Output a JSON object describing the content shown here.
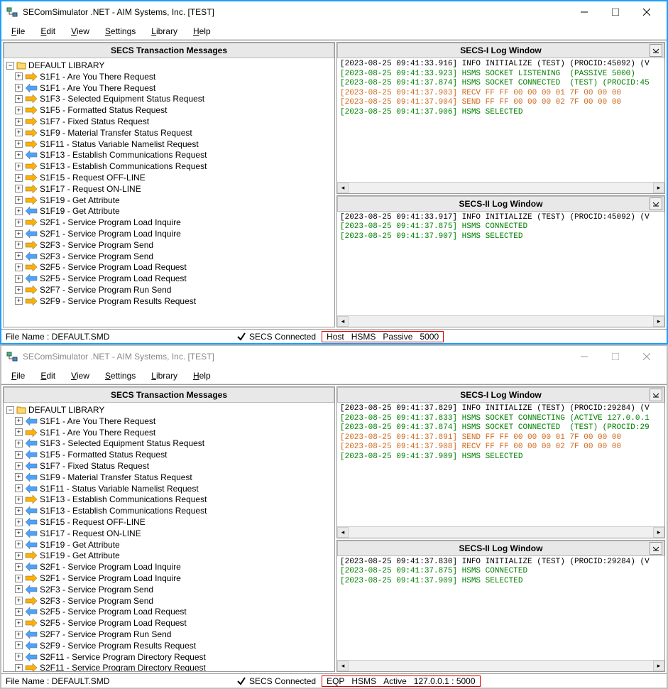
{
  "windows": [
    {
      "active": true,
      "title": "SEComSimulator .NET - AIM Systems, Inc. [TEST]",
      "menu": [
        {
          "label": "File",
          "u": 0
        },
        {
          "label": "Edit",
          "u": 0
        },
        {
          "label": "View",
          "u": 0
        },
        {
          "label": "Settings",
          "u": 0
        },
        {
          "label": "Library",
          "u": 0
        },
        {
          "label": "Help",
          "u": 0
        }
      ],
      "tree_header": "SECS Transaction Messages",
      "library_label": "DEFAULT LIBRARY",
      "tree_items": [
        {
          "dir": "out",
          "label": "S1F1 - Are You There Request"
        },
        {
          "dir": "in",
          "label": "S1F1 - Are You There Request"
        },
        {
          "dir": "out",
          "label": "S1F3 - Selected Equipment Status Request"
        },
        {
          "dir": "out",
          "label": "S1F5 - Formatted Status Request"
        },
        {
          "dir": "out",
          "label": "S1F7 - Fixed Status Request"
        },
        {
          "dir": "out",
          "label": "S1F9 - Material Transfer Status Request"
        },
        {
          "dir": "out",
          "label": "S1F11 - Status Variable Namelist Request"
        },
        {
          "dir": "in",
          "label": "S1F13 - Establish Communications Request"
        },
        {
          "dir": "out",
          "label": "S1F13 - Establish Communications Request"
        },
        {
          "dir": "out",
          "label": "S1F15 - Request OFF-LINE"
        },
        {
          "dir": "out",
          "label": "S1F17 - Request ON-LINE"
        },
        {
          "dir": "out",
          "label": "S1F19 - Get Attribute"
        },
        {
          "dir": "in",
          "label": "S1F19 - Get Attribute"
        },
        {
          "dir": "out",
          "label": "S2F1 - Service Program Load Inquire"
        },
        {
          "dir": "in",
          "label": "S2F1 - Service Program Load Inquire"
        },
        {
          "dir": "out",
          "label": "S2F3 - Service Program Send"
        },
        {
          "dir": "in",
          "label": "S2F3 - Service Program Send"
        },
        {
          "dir": "out",
          "label": "S2F5 - Service Program Load Request"
        },
        {
          "dir": "in",
          "label": "S2F5 - Service Program Load Request"
        },
        {
          "dir": "out",
          "label": "S2F7 - Service Program Run Send"
        },
        {
          "dir": "out",
          "label": "S2F9 - Service Program Results Request"
        }
      ],
      "log1_header": "SECS-I Log Window",
      "log1_lines": [
        {
          "cls": "c-info",
          "text": "[2023-08-25 09:41:33.916] INFO INITIALIZE (TEST) (PROCID:45092) (V"
        },
        {
          "cls": "c-green",
          "text": "[2023-08-25 09:41:33.923] HSMS SOCKET LISTENING  (PASSIVE 5000)"
        },
        {
          "cls": "c-green",
          "text": "[2023-08-25 09:41:37.874] HSMS SOCKET CONNECTED  (TEST) (PROCID:45"
        },
        {
          "cls": "c-orange",
          "text": "[2023-08-25 09:41:37.903] RECV FF FF 00 00 00 01 7F 00 00 00"
        },
        {
          "cls": "c-orange",
          "text": "[2023-08-25 09:41:37.904] SEND FF FF 00 00 00 02 7F 00 00 00"
        },
        {
          "cls": "c-green",
          "text": "[2023-08-25 09:41:37.906] HSMS SELECTED"
        }
      ],
      "log2_header": "SECS-II Log Window",
      "log2_lines": [
        {
          "cls": "c-info",
          "text": "[2023-08-25 09:41:33.917] INFO INITIALIZE (TEST) (PROCID:45092) (V"
        },
        {
          "cls": "c-green",
          "text": "[2023-08-25 09:41:37.875] HSMS CONNECTED"
        },
        {
          "cls": "c-green",
          "text": "[2023-08-25 09:41:37.907] HSMS SELECTED"
        }
      ],
      "status_filename": "File Name : DEFAULT.SMD",
      "status_conn": "SECS Connected",
      "status_mode": [
        "Host",
        "HSMS",
        "Passive",
        "5000"
      ]
    },
    {
      "active": false,
      "title": "SEComSimulator .NET - AIM Systems, Inc. [TEST]",
      "menu": [
        {
          "label": "File",
          "u": 0
        },
        {
          "label": "Edit",
          "u": 0
        },
        {
          "label": "View",
          "u": 0
        },
        {
          "label": "Settings",
          "u": 0
        },
        {
          "label": "Library",
          "u": 0
        },
        {
          "label": "Help",
          "u": 0
        }
      ],
      "tree_header": "SECS Transaction Messages",
      "library_label": "DEFAULT LIBRARY",
      "tree_items": [
        {
          "dir": "in",
          "label": "S1F1 - Are You There Request"
        },
        {
          "dir": "out",
          "label": "S1F1 - Are You There Request"
        },
        {
          "dir": "in",
          "label": "S1F3 - Selected Equipment Status Request"
        },
        {
          "dir": "in",
          "label": "S1F5 - Formatted Status Request"
        },
        {
          "dir": "in",
          "label": "S1F7 - Fixed Status Request"
        },
        {
          "dir": "in",
          "label": "S1F9 - Material Transfer Status Request"
        },
        {
          "dir": "in",
          "label": "S1F11 - Status Variable Namelist Request"
        },
        {
          "dir": "out",
          "label": "S1F13 - Establish Communications Request"
        },
        {
          "dir": "in",
          "label": "S1F13 - Establish Communications Request"
        },
        {
          "dir": "in",
          "label": "S1F15 - Request OFF-LINE"
        },
        {
          "dir": "in",
          "label": "S1F17 - Request ON-LINE"
        },
        {
          "dir": "in",
          "label": "S1F19 - Get Attribute"
        },
        {
          "dir": "out",
          "label": "S1F19 - Get Attribute"
        },
        {
          "dir": "in",
          "label": "S2F1 - Service Program Load Inquire"
        },
        {
          "dir": "out",
          "label": "S2F1 - Service Program Load Inquire"
        },
        {
          "dir": "in",
          "label": "S2F3 - Service Program Send"
        },
        {
          "dir": "out",
          "label": "S2F3 - Service Program Send"
        },
        {
          "dir": "in",
          "label": "S2F5 - Service Program Load Request"
        },
        {
          "dir": "out",
          "label": "S2F5 - Service Program Load Request"
        },
        {
          "dir": "in",
          "label": "S2F7 - Service Program Run Send"
        },
        {
          "dir": "in",
          "label": "S2F9 - Service Program Results Request"
        },
        {
          "dir": "in",
          "label": "S2F11 - Service Program Directory Request"
        },
        {
          "dir": "out",
          "label": "S2F11 - Service Program Directory Request"
        }
      ],
      "log1_header": "SECS-I Log Window",
      "log1_lines": [
        {
          "cls": "c-info",
          "text": "[2023-08-25 09:41:37.829] INFO INITIALIZE (TEST) (PROCID:29284) (V"
        },
        {
          "cls": "c-green",
          "text": "[2023-08-25 09:41:37.833] HSMS SOCKET CONNECTING (ACTIVE 127.0.0.1"
        },
        {
          "cls": "c-green",
          "text": "[2023-08-25 09:41:37.874] HSMS SOCKET CONNECTED  (TEST) (PROCID:29"
        },
        {
          "cls": "c-orange",
          "text": "[2023-08-25 09:41:37.891] SEND FF FF 00 00 00 01 7F 00 00 00"
        },
        {
          "cls": "c-orange",
          "text": "[2023-08-25 09:41:37.908] RECV FF FF 00 00 00 02 7F 00 00 00"
        },
        {
          "cls": "c-green",
          "text": "[2023-08-25 09:41:37.909] HSMS SELECTED"
        }
      ],
      "log2_header": "SECS-II Log Window",
      "log2_lines": [
        {
          "cls": "c-info",
          "text": "[2023-08-25 09:41:37.830] INFO INITIALIZE (TEST) (PROCID:29284) (V"
        },
        {
          "cls": "c-green",
          "text": "[2023-08-25 09:41:37.875] HSMS CONNECTED"
        },
        {
          "cls": "c-green",
          "text": "[2023-08-25 09:41:37.909] HSMS SELECTED"
        }
      ],
      "status_filename": "File Name : DEFAULT.SMD",
      "status_conn": "SECS Connected",
      "status_mode": [
        "EQP",
        "HSMS",
        "Active",
        "127.0.0.1 : 5000"
      ]
    }
  ]
}
